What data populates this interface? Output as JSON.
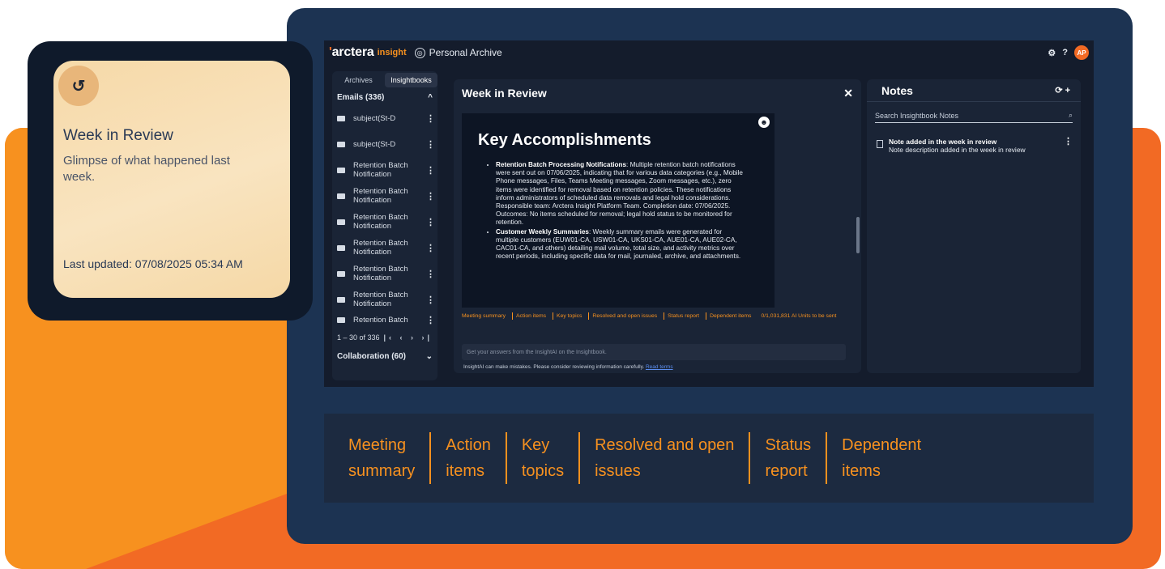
{
  "app": {
    "logo": "arctera",
    "logo_sub": "insight",
    "archive_title": "Personal Archive",
    "avatar_initials": "AP",
    "help": "?"
  },
  "left_panel": {
    "tabs": [
      "Archives",
      "Insightbooks"
    ],
    "emails_group": "Emails (336)",
    "items": [
      "subject(St-D",
      "subject(St-D",
      "Retention Batch Notification",
      "Retention Batch Notification",
      "Retention Batch Notification",
      "Retention Batch Notification",
      "Retention Batch Notification",
      "Retention Batch Notification",
      "Retention Batch"
    ],
    "pager": "1 – 30 of 336",
    "collab_group": "Collaboration (60)"
  },
  "center": {
    "title": "Week in Review",
    "doc_heading": "Key Accomplishments",
    "bullets": [
      {
        "bold": "Retention Batch Processing Notifications",
        "text": ": Multiple retention batch notifications were sent out on 07/06/2025, indicating that for various data categories (e.g., Mobile Phone messages, Files, Teams Meeting messages, Zoom messages, etc.), zero items were identified for removal based on retention policies. These notifications inform administrators of scheduled data removals and legal hold considerations. Responsible team: Arctera Insight Platform Team. Completion date: 07/06/2025. Outcomes: No items scheduled for removal; legal hold status to be monitored for retention."
      },
      {
        "bold": "Customer Weekly Summaries",
        "text": ": Weekly summary emails were generated for multiple customers (EUW01-CA, USW01-CA, UKS01-CA, AUE01-CA, AUE02-CA, CAC01-CA, and others) detailing mail volume, total size, and activity metrics over recent periods, including specific data for mail, journaled, archive, and attachments."
      }
    ],
    "chips": [
      "Meeting summary",
      "Action items",
      "Key topics",
      "Resolved and open issues",
      "Status report",
      "Dependent items"
    ],
    "units": "0/1,031,831 AI Units to be sent",
    "input_placeholder": "Get your answers from the InsightAI on the Insightbook.",
    "disclaimer": "InsightAI can make mistakes. Please consider reviewing information carefully.",
    "disclaimer_link": "Read terms"
  },
  "notes": {
    "title": "Notes",
    "search_placeholder": "Search Insightbook Notes",
    "note_title": "Note added in the week in review",
    "note_desc": "Note description added in the week in review"
  },
  "bottom_bar": [
    [
      "Meeting",
      "summary"
    ],
    [
      "Action",
      "items"
    ],
    [
      "Key",
      "topics"
    ],
    [
      "Resolved and open",
      "issues"
    ],
    [
      "Status",
      "report"
    ],
    [
      "Dependent",
      "items"
    ]
  ],
  "card": {
    "title": "Week in Review",
    "subtitle": "Glimpse of what happened last week.",
    "updated": "Last updated: 07/08/2025 05:34 AM"
  },
  "colors": {
    "accent_orange": "#f26a24",
    "accent_amber": "#f7911f",
    "device_navy": "#1c3352",
    "app_bg": "#141c2c"
  }
}
